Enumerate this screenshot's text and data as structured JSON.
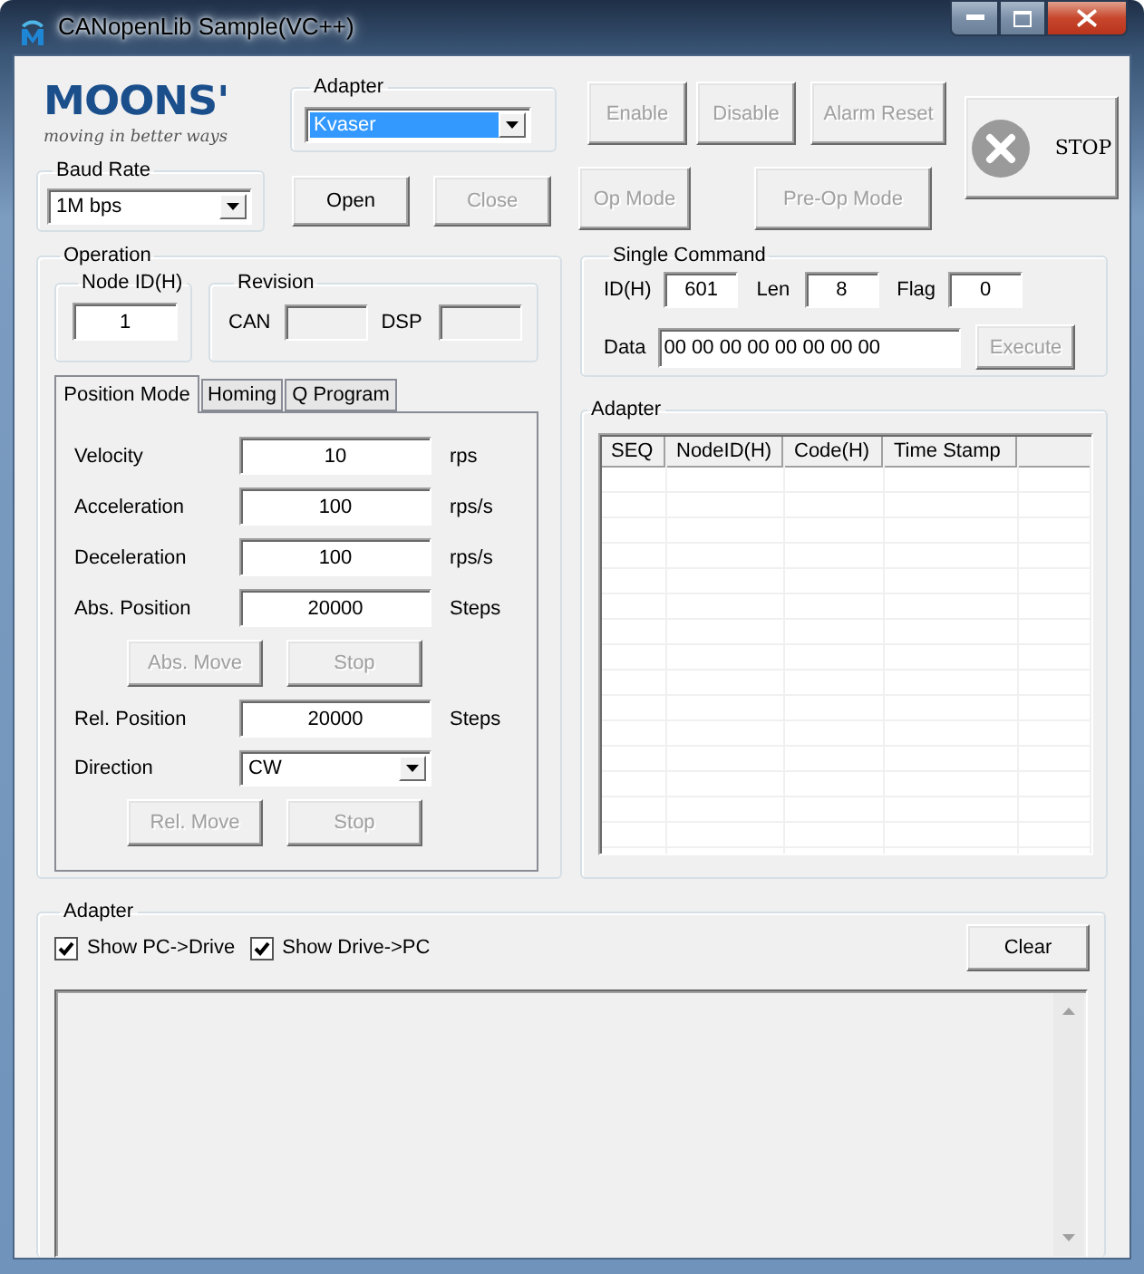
{
  "window": {
    "title": "CANopenLib Sample(VC++)"
  },
  "logo": {
    "wordmark": "MOONS'",
    "tagline": "moving in better ways"
  },
  "adapter_select": {
    "label": "Adapter",
    "value": "Kvaser",
    "highlighted": true
  },
  "baud_rate": {
    "label": "Baud Rate",
    "value": "1M bps"
  },
  "connection_buttons": [
    {
      "label": "Open",
      "disabled": false
    },
    {
      "label": "Close",
      "disabled": true
    }
  ],
  "drive_buttons": [
    {
      "label": "Enable",
      "disabled": true
    },
    {
      "label": "Disable",
      "disabled": true
    },
    {
      "label": "Alarm Reset",
      "disabled": true
    }
  ],
  "mode_buttons": [
    {
      "label": "Op Mode",
      "disabled": true
    },
    {
      "label": "Pre-Op Mode",
      "disabled": true
    }
  ],
  "stop_button": {
    "label": "STOP"
  },
  "operation": {
    "label": "Operation",
    "node_id": {
      "label": "Node ID(H)",
      "value": "1"
    },
    "revision": {
      "label": "Revision",
      "fields": [
        {
          "label": "CAN"
        },
        {
          "label": "DSP"
        }
      ]
    }
  },
  "tabs": [
    {
      "label": "Position Mode",
      "selected": true
    },
    {
      "label": "Homing",
      "selected": false
    },
    {
      "label": "Q Program",
      "selected": false
    }
  ],
  "position_mode": {
    "rows": [
      {
        "kind": "field",
        "label": "Velocity",
        "value": "10",
        "unit": "rps"
      },
      {
        "kind": "field",
        "label": "Acceleration",
        "value": "100",
        "unit": "rps/s"
      },
      {
        "kind": "field",
        "label": "Deceleration",
        "value": "100",
        "unit": "rps/s"
      },
      {
        "kind": "field",
        "label": "Abs. Position",
        "value": "20000",
        "unit": "Steps"
      },
      {
        "kind": "buttons",
        "buttons": [
          {
            "label": "Abs. Move",
            "disabled": true
          },
          {
            "label": "Stop",
            "disabled": true
          }
        ]
      },
      {
        "kind": "field",
        "label": "Rel. Position",
        "value": "20000",
        "unit": "Steps"
      },
      {
        "kind": "select",
        "label": "Direction",
        "value": "CW"
      },
      {
        "kind": "buttons",
        "buttons": [
          {
            "label": "Rel. Move",
            "disabled": true
          },
          {
            "label": "Stop",
            "disabled": true
          }
        ]
      }
    ]
  },
  "single_command": {
    "label": "Single Command",
    "fields": [
      {
        "label": "ID(H)",
        "value": "601"
      },
      {
        "label": "Len",
        "value": "8"
      },
      {
        "label": "Flag",
        "value": "0"
      }
    ],
    "data": {
      "label": "Data",
      "value": "00 00 00 00 00 00 00 00"
    },
    "execute": {
      "label": "Execute",
      "disabled": true
    }
  },
  "message_list": {
    "label": "Adapter",
    "columns": [
      "SEQ",
      "NodeID(H)",
      "Code(H)",
      "Time Stamp"
    ]
  },
  "log": {
    "label": "Adapter",
    "checkboxes": [
      {
        "label": "Show PC->Drive",
        "checked": true
      },
      {
        "label": "Show Drive->PC",
        "checked": true
      }
    ],
    "clear": {
      "label": "Clear",
      "disabled": false
    }
  }
}
